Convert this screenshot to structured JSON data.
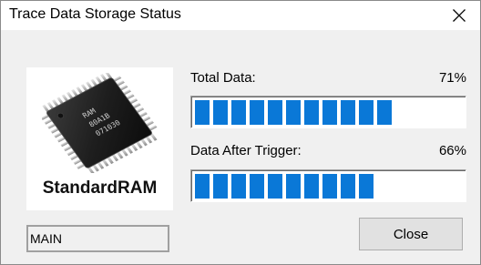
{
  "window": {
    "title": "Trace Data Storage Status"
  },
  "chip": {
    "label": "StandardRAM",
    "marking_line1": "RAM",
    "marking_line2": "80A1B",
    "marking_line3": "071030"
  },
  "status_field": {
    "value": "MAIN"
  },
  "total_data": {
    "label": "Total Data:",
    "percent_text": "71%",
    "progress": 71
  },
  "after_trigger": {
    "label": "Data After Trigger:",
    "percent_text": "66%",
    "progress": 66
  },
  "buttons": {
    "close_label": "Close"
  },
  "colors": {
    "progress_fill": "#0a78d7",
    "window_bg": "#f0f0f0"
  },
  "icons": {
    "window_close": "close-icon",
    "chip": "chip-icon"
  }
}
